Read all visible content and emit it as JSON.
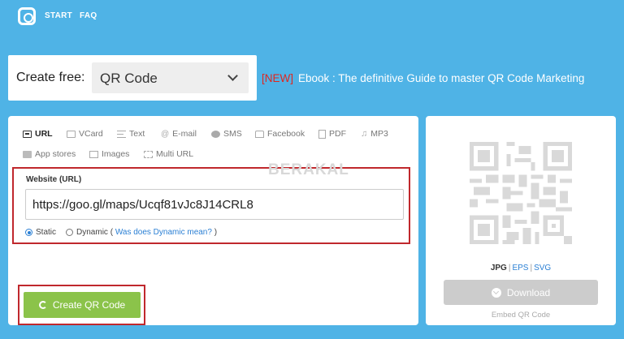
{
  "nav": {
    "start": "START",
    "faq": "FAQ"
  },
  "create": {
    "label": "Create free:",
    "selected": "QR Code"
  },
  "promo": {
    "badge": "[NEW]",
    "text": "Ebook : The definitive Guide to master QR Code Marketing"
  },
  "tabs": [
    {
      "label": "URL",
      "icon": "url-icon",
      "active": true
    },
    {
      "label": "VCard",
      "icon": "vcard-icon"
    },
    {
      "label": "Text",
      "icon": "text-icon"
    },
    {
      "label": "E-mail",
      "icon": "email-icon"
    },
    {
      "label": "SMS",
      "icon": "sms-icon"
    },
    {
      "label": "Facebook",
      "icon": "facebook-icon"
    },
    {
      "label": "PDF",
      "icon": "pdf-icon"
    },
    {
      "label": "MP3",
      "icon": "mp3-icon"
    },
    {
      "label": "App stores",
      "icon": "app-stores-icon"
    },
    {
      "label": "Images",
      "icon": "images-icon"
    },
    {
      "label": "Multi URL",
      "icon": "multi-url-icon"
    }
  ],
  "watermark": "BERAKAL",
  "form": {
    "label": "Website (URL)",
    "value": "https://goo.gl/maps/Ucqf81vJc8J14CRL8",
    "static_label": "Static",
    "static_selected": true,
    "dynamic_label": "Dynamic (",
    "dynamic_link": "Was does Dynamic mean?",
    "dynamic_close": ")"
  },
  "create_button": "Create QR Code",
  "output": {
    "formats": [
      "JPG",
      "EPS",
      "SVG"
    ],
    "download": "Download",
    "embed": "Embed QR Code"
  },
  "colors": {
    "background": "#4fb3e6",
    "accent_green": "#8bc34a",
    "highlight_red": "#c0282d",
    "new_badge": "#e0261f"
  }
}
